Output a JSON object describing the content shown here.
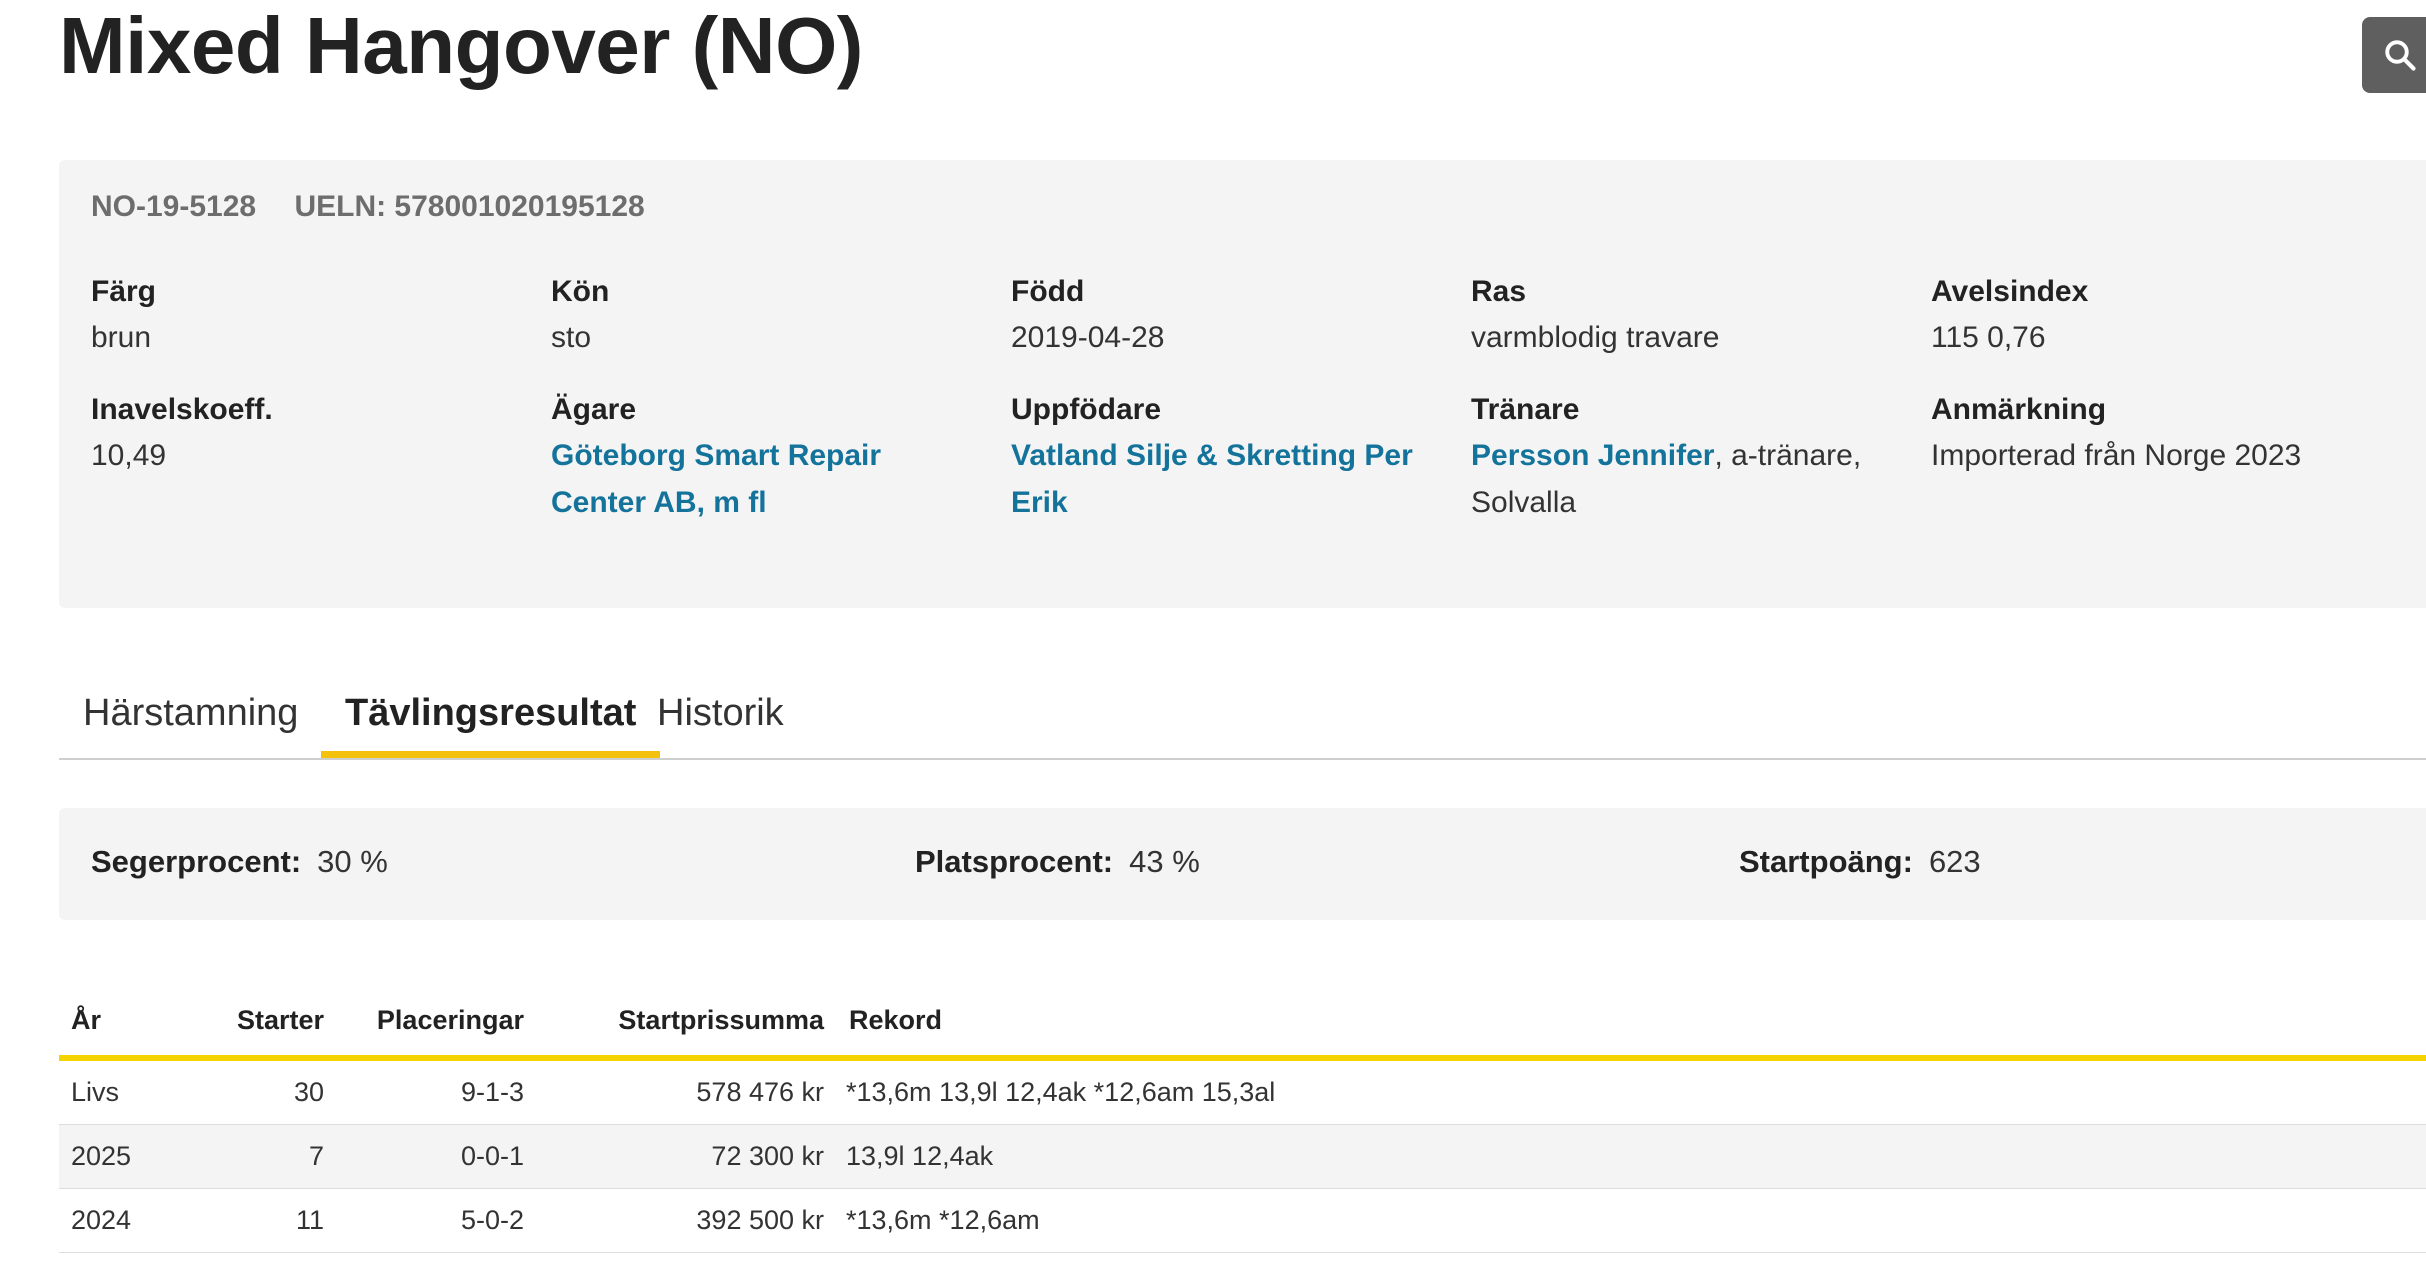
{
  "header": {
    "title": "Mixed Hangover (NO)"
  },
  "search": {
    "icon": "search-icon"
  },
  "identifiers": {
    "reg_no": "NO-19-5128",
    "ueln": "UELN: 578001020195128"
  },
  "fields": {
    "farg": {
      "label": "Färg",
      "value": "brun"
    },
    "kon": {
      "label": "Kön",
      "value": "sto"
    },
    "fodd": {
      "label": "Född",
      "value": "2019-04-28"
    },
    "ras": {
      "label": "Ras",
      "value": "varmblodig travare"
    },
    "avelsindex": {
      "label": "Avelsindex",
      "value": "115 0,76"
    },
    "inavel": {
      "label": "Inavelskoeff.",
      "value": "10,49"
    },
    "agare": {
      "label": "Ägare",
      "value": "Göteborg Smart Repair Center AB, m fl"
    },
    "uppfodare": {
      "label": "Uppfödare",
      "value": "Vatland Silje & Skretting Per Erik"
    },
    "tranare": {
      "label": "Tränare",
      "link": "Persson Jennifer",
      "suffix": ", a-tränare, Solvalla"
    },
    "anmarkning": {
      "label": "Anmärkning",
      "value": "Importerad från Norge 2023"
    }
  },
  "tabs": [
    {
      "label": "Härstamning",
      "active": false
    },
    {
      "label": "Tävlingsresultat",
      "active": true
    },
    {
      "label": "Historik",
      "active": false
    }
  ],
  "stats": {
    "seger": {
      "label": "Segerprocent:",
      "value": "30 %"
    },
    "plats": {
      "label": "Platsprocent:",
      "value": "43 %"
    },
    "startpoang": {
      "label": "Startpoäng:",
      "value": "623"
    }
  },
  "table": {
    "headers": [
      "År",
      "Starter",
      "Placeringar",
      "Startprissumma",
      "Rekord"
    ],
    "rows": [
      [
        "Livs",
        "30",
        "9-1-3",
        "578 476 kr",
        "*13,6m 13,9l 12,4ak *12,6am 15,3al"
      ],
      [
        "2025",
        "7",
        "0-0-1",
        "72 300 kr",
        "13,9l 12,4ak"
      ],
      [
        "2024",
        "11",
        "5-0-2",
        "392 500 kr",
        "*13,6m *12,6am"
      ]
    ]
  },
  "colors": {
    "link": "#14739b",
    "accent_yellow": "#f4c20d",
    "panel_bg": "#f4f4f4",
    "search_bg": "#5f5f5f"
  }
}
